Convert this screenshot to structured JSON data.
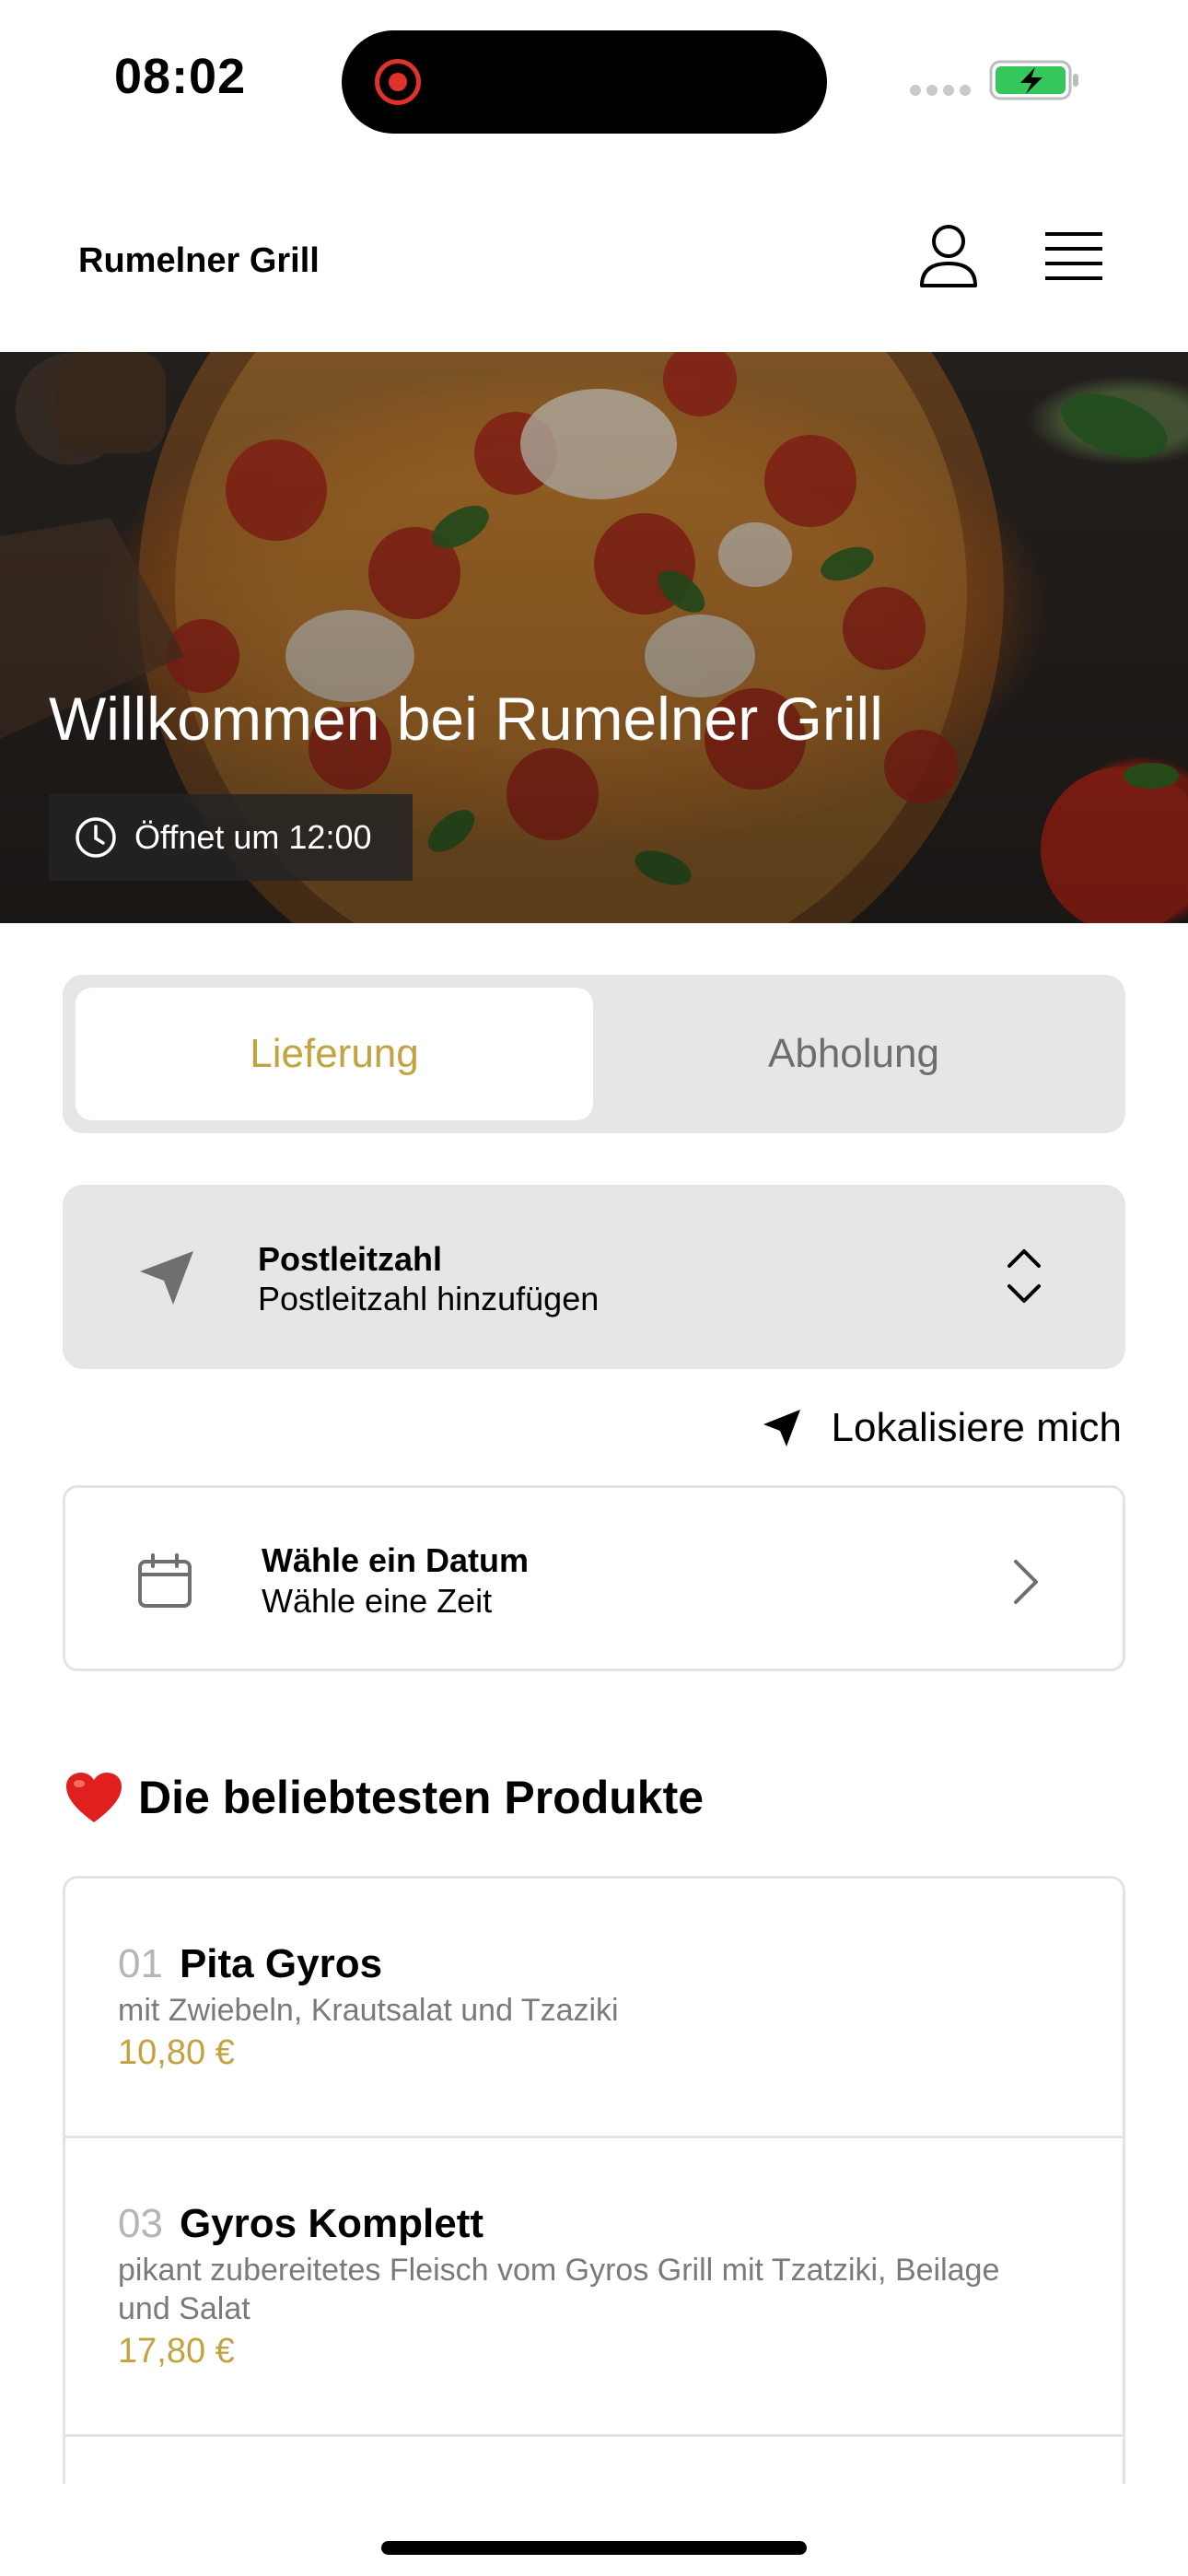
{
  "status_bar": {
    "time": "08:02",
    "icons": [
      "recording-indicator-icon",
      "signal-icon",
      "battery-charging-icon"
    ]
  },
  "header": {
    "brand": "Rumelner Grill",
    "icons": [
      "user-icon",
      "menu-icon"
    ]
  },
  "hero": {
    "title": "Willkommen bei Rumelner Grill",
    "opening_text": "Öffnet um 12:00",
    "icon": "clock-icon"
  },
  "order_type": {
    "options": [
      "Lieferung",
      "Abholung"
    ],
    "selected": "Lieferung"
  },
  "postcode": {
    "title": "Postleitzahl",
    "placeholder": "Postleitzahl hinzufügen",
    "icon": "location-arrow-icon"
  },
  "locate": {
    "label": "Lokalisiere mich",
    "icon": "location-arrow-icon"
  },
  "datetime": {
    "title": "Wähle ein Datum",
    "subtitle": "Wähle eine Zeit",
    "icon": "calendar-icon"
  },
  "popular": {
    "title": "Die beliebtesten Produkte",
    "icon": "heart-icon",
    "items": [
      {
        "number": "01",
        "name": "Pita Gyros",
        "description": "mit Zwiebeln, Krautsalat und Tzaziki",
        "price": "10,80 €"
      },
      {
        "number": "03",
        "name": "Gyros Komplett",
        "description": "pikant zubereitetes Fleisch vom Gyros Grill mit Tzatziki, Beilage und Salat",
        "price": "17,80 €"
      }
    ]
  },
  "colors": {
    "accent": "#c2a33f",
    "panel_gray": "#e6e6e6",
    "border": "#e3e3e3",
    "recording_red": "#e0322c",
    "battery_green": "#34c759"
  }
}
